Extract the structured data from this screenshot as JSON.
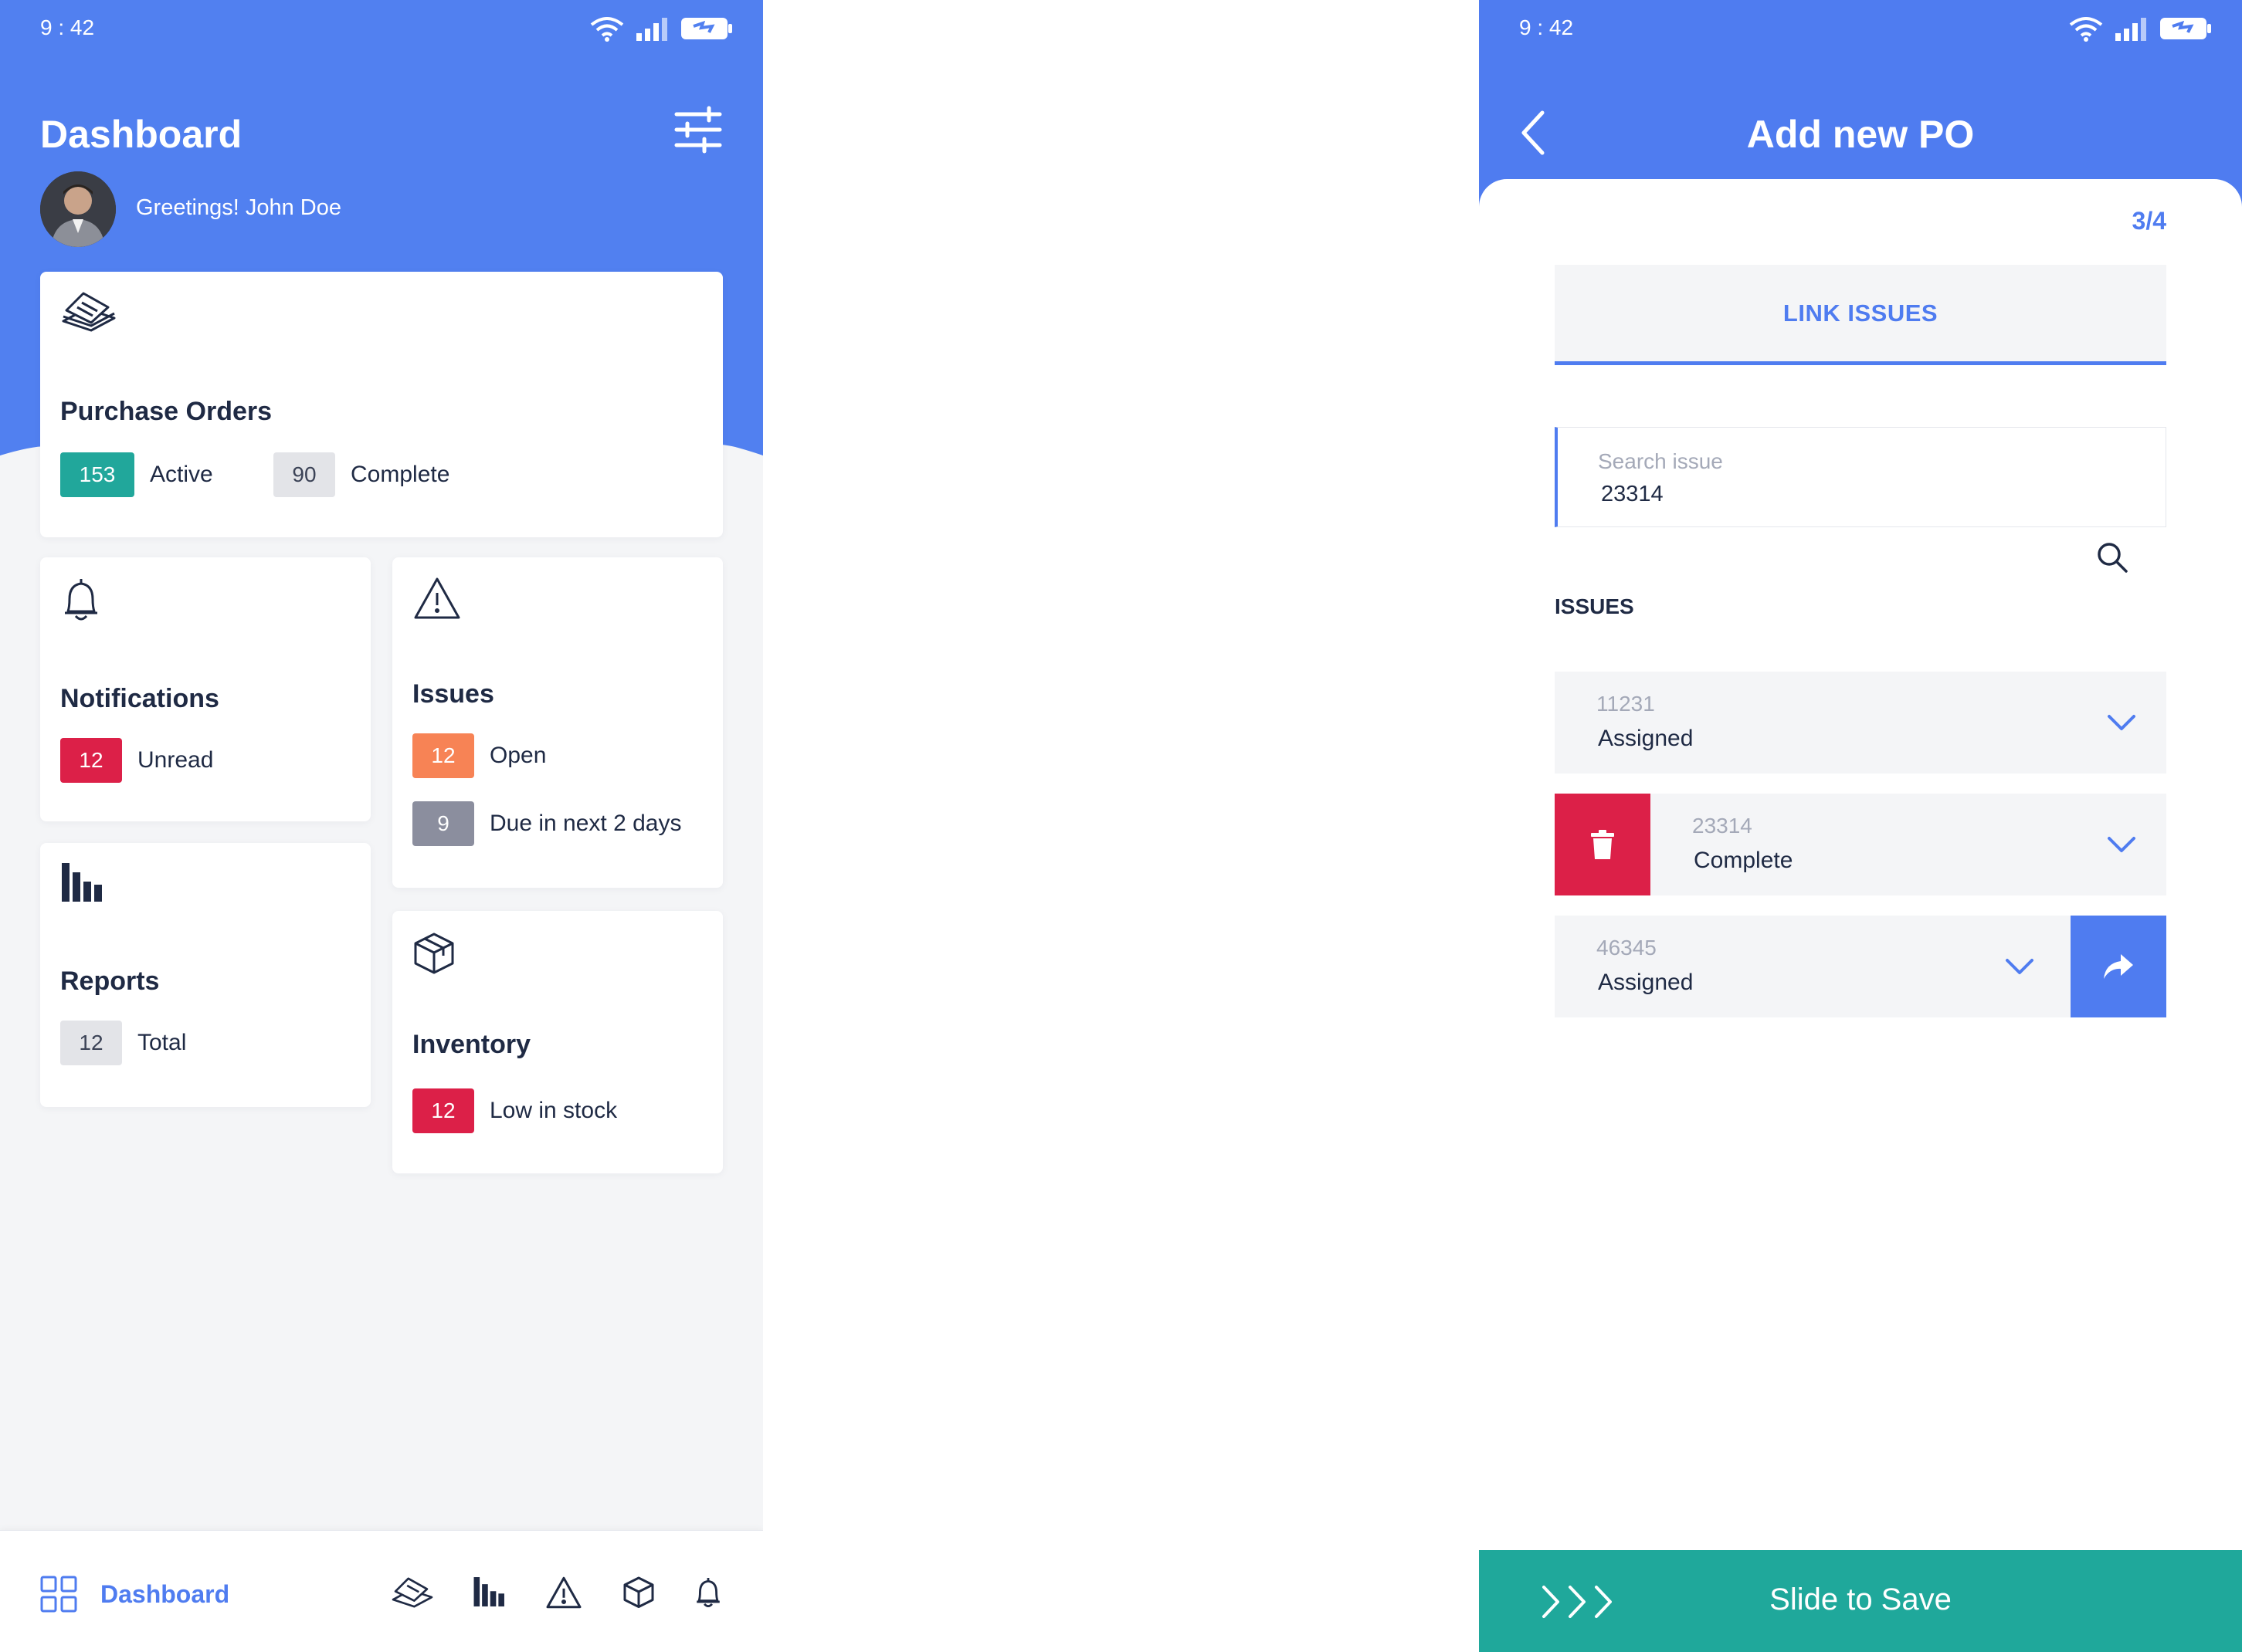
{
  "status_bar": {
    "time": "9 : 42"
  },
  "dashboard": {
    "title": "Dashboard",
    "greeting": "Greetings! John Doe",
    "cards": {
      "purchase_orders": {
        "title": "Purchase Orders",
        "active_count": "153",
        "active_label": "Active",
        "complete_count": "90",
        "complete_label": "Complete"
      },
      "notifications": {
        "title": "Notifications",
        "unread_count": "12",
        "unread_label": "Unread"
      },
      "issues": {
        "title": "Issues",
        "open_count": "12",
        "open_label": "Open",
        "due_count": "9",
        "due_label": "Due in next 2 days"
      },
      "reports": {
        "title": "Reports",
        "total_count": "12",
        "total_label": "Total"
      },
      "inventory": {
        "title": "Inventory",
        "low_count": "12",
        "low_label": "Low in stock"
      }
    },
    "bottom_nav": {
      "active_label": "Dashboard",
      "icons": [
        "dashboard-grid-icon",
        "purchase-orders-icon",
        "reports-icon",
        "issues-icon",
        "inventory-icon",
        "notifications-icon"
      ]
    }
  },
  "add_po": {
    "title": "Add new PO",
    "step": "3/4",
    "tab_label": "LINK ISSUES",
    "search": {
      "placeholder": "Search issue",
      "value": "23314"
    },
    "issues_heading": "ISSUES",
    "issues": [
      {
        "id": "11231",
        "status": "Assigned"
      },
      {
        "id": "23314",
        "status": "Complete"
      },
      {
        "id": "46345",
        "status": "Assigned"
      }
    ],
    "slide_label": "Slide to Save"
  },
  "colors": {
    "primary": "#4f7cf0",
    "teal": "#21a79b",
    "red": "#dc2048",
    "orange": "#f78355",
    "slate": "#8b8e9e",
    "background": "#f4f5f7",
    "text": "#1f2a44"
  }
}
